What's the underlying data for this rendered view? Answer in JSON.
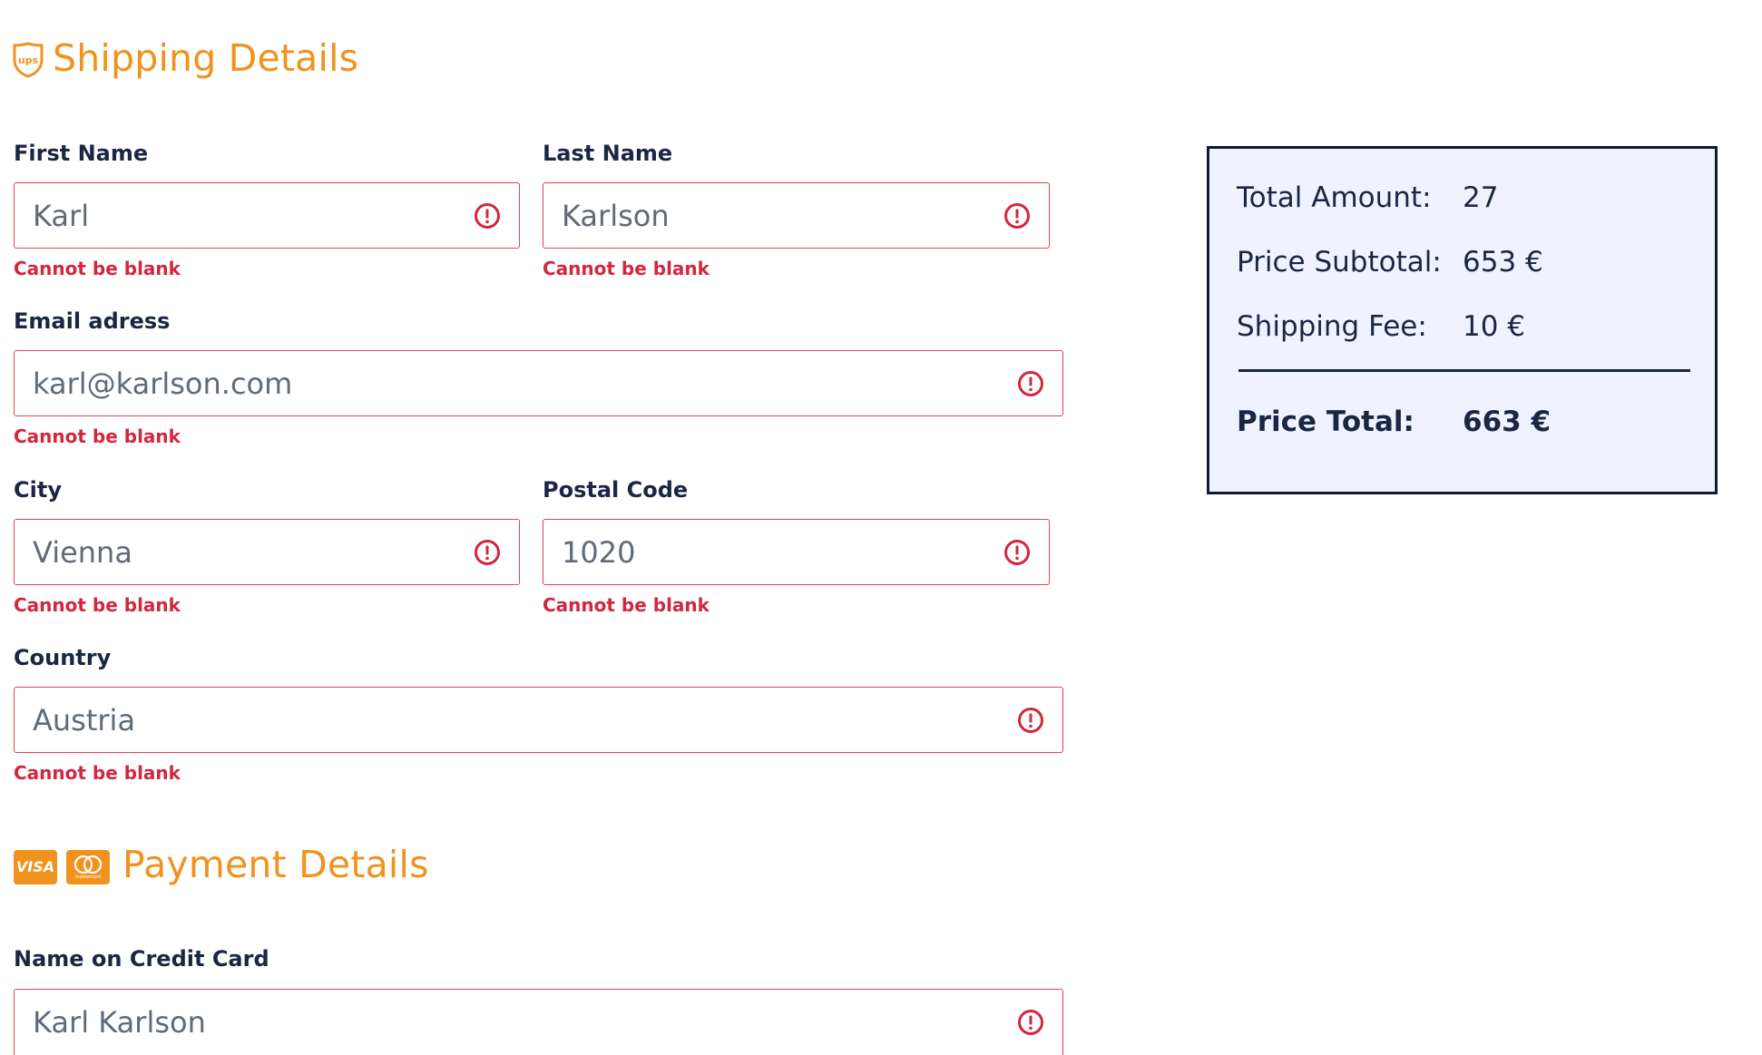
{
  "shipping": {
    "title": "Shipping Details",
    "fields": {
      "first_name": {
        "label": "First Name",
        "value": "Karl",
        "error": "Cannot be blank"
      },
      "last_name": {
        "label": "Last Name",
        "value": "Karlson",
        "error": "Cannot be blank"
      },
      "email": {
        "label": "Email adress",
        "value": "karl@karlson.com",
        "error": "Cannot be blank"
      },
      "city": {
        "label": "City",
        "value": "Vienna",
        "error": "Cannot be blank"
      },
      "postal_code": {
        "label": "Postal Code",
        "value": "1020",
        "error": "Cannot be blank"
      },
      "country": {
        "label": "Country",
        "value": "Austria",
        "error": "Cannot be blank"
      }
    }
  },
  "payment": {
    "title": "Payment Details",
    "card_brands": [
      "VISA",
      "mastercard"
    ],
    "fields": {
      "card_name": {
        "label": "Name on Credit Card",
        "value": "Karl Karlson"
      }
    }
  },
  "summary": {
    "total_amount_label": "Total Amount:",
    "total_amount_value": "27",
    "subtotal_label": "Price Subtotal:",
    "subtotal_value": "653 €",
    "shipping_label": "Shipping Fee:",
    "shipping_value": "10 €",
    "total_label": "Price Total:",
    "total_value": "663 €"
  },
  "icons": {
    "shipping": "ups-shield-icon",
    "visa": "visa-card-icon",
    "mastercard": "mastercard-icon",
    "error": "exclamation-circle-icon"
  },
  "colors": {
    "accent": "#f0931e",
    "error": "#d1273f",
    "text": "#1a2744",
    "summary_bg": "#eef3ff"
  }
}
